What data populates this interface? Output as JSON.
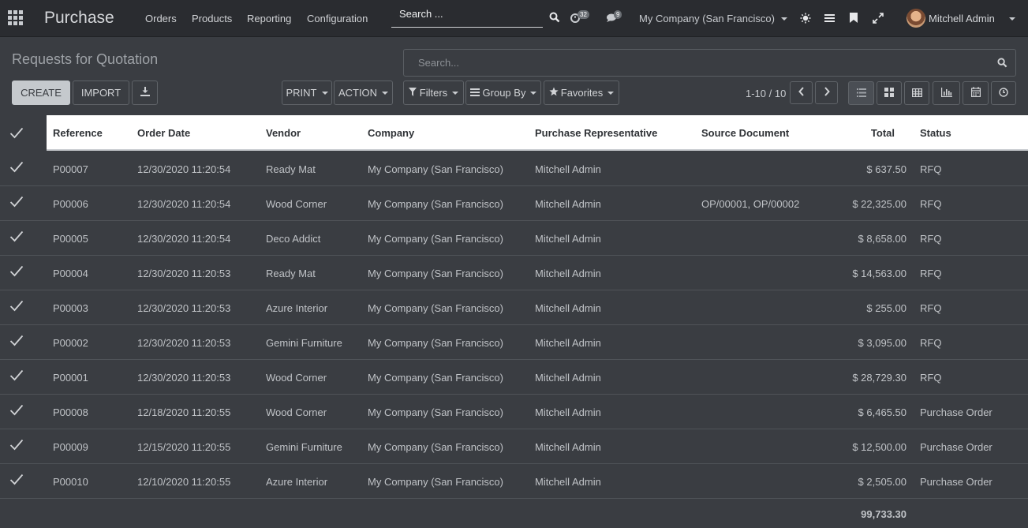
{
  "navbar": {
    "app_title": "Purchase",
    "menu": [
      "Orders",
      "Products",
      "Reporting",
      "Configuration"
    ],
    "search_label": "Search ...",
    "activity_badge": "32",
    "messages_badge": "9",
    "company": "My Company (San Francisco)",
    "user": "Mitchell Admin"
  },
  "control_panel": {
    "title": "Requests for Quotation",
    "search_placeholder": "Search...",
    "create_label": "CREATE",
    "import_label": "IMPORT",
    "print_label": "PRINT",
    "action_label": "ACTION",
    "filters_label": "Filters",
    "groupby_label": "Group By",
    "favorites_label": "Favorites",
    "pager": "1-10 / 10"
  },
  "table": {
    "headers": [
      "Reference",
      "Order Date",
      "Vendor",
      "Company",
      "Purchase Representative",
      "Source Document",
      "Total",
      "Status"
    ],
    "rows": [
      {
        "ref": "P00007",
        "date": "12/30/2020 11:20:54",
        "vendor": "Ready Mat",
        "company": "My Company (San Francisco)",
        "rep": "Mitchell Admin",
        "source": "",
        "total": "$ 637.50",
        "status": "RFQ"
      },
      {
        "ref": "P00006",
        "date": "12/30/2020 11:20:54",
        "vendor": "Wood Corner",
        "company": "My Company (San Francisco)",
        "rep": "Mitchell Admin",
        "source": "OP/00001, OP/00002",
        "total": "$ 22,325.00",
        "status": "RFQ"
      },
      {
        "ref": "P00005",
        "date": "12/30/2020 11:20:54",
        "vendor": "Deco Addict",
        "company": "My Company (San Francisco)",
        "rep": "Mitchell Admin",
        "source": "",
        "total": "$ 8,658.00",
        "status": "RFQ"
      },
      {
        "ref": "P00004",
        "date": "12/30/2020 11:20:53",
        "vendor": "Ready Mat",
        "company": "My Company (San Francisco)",
        "rep": "Mitchell Admin",
        "source": "",
        "total": "$ 14,563.00",
        "status": "RFQ"
      },
      {
        "ref": "P00003",
        "date": "12/30/2020 11:20:53",
        "vendor": "Azure Interior",
        "company": "My Company (San Francisco)",
        "rep": "Mitchell Admin",
        "source": "",
        "total": "$ 255.00",
        "status": "RFQ"
      },
      {
        "ref": "P00002",
        "date": "12/30/2020 11:20:53",
        "vendor": "Gemini Furniture",
        "company": "My Company (San Francisco)",
        "rep": "Mitchell Admin",
        "source": "",
        "total": "$ 3,095.00",
        "status": "RFQ"
      },
      {
        "ref": "P00001",
        "date": "12/30/2020 11:20:53",
        "vendor": "Wood Corner",
        "company": "My Company (San Francisco)",
        "rep": "Mitchell Admin",
        "source": "",
        "total": "$ 28,729.30",
        "status": "RFQ"
      },
      {
        "ref": "P00008",
        "date": "12/18/2020 11:20:55",
        "vendor": "Wood Corner",
        "company": "My Company (San Francisco)",
        "rep": "Mitchell Admin",
        "source": "",
        "total": "$ 6,465.50",
        "status": "Purchase Order"
      },
      {
        "ref": "P00009",
        "date": "12/15/2020 11:20:55",
        "vendor": "Gemini Furniture",
        "company": "My Company (San Francisco)",
        "rep": "Mitchell Admin",
        "source": "",
        "total": "$ 12,500.00",
        "status": "Purchase Order"
      },
      {
        "ref": "P00010",
        "date": "12/10/2020 11:20:55",
        "vendor": "Azure Interior",
        "company": "My Company (San Francisco)",
        "rep": "Mitchell Admin",
        "source": "",
        "total": "$ 2,505.00",
        "status": "Purchase Order"
      }
    ],
    "grand_total": "99,733.30"
  },
  "colors": {
    "background": "#3a3d42",
    "navbar": "#2a2c30",
    "header_bg": "#ffffff",
    "primary_button": "#c5c9cd"
  }
}
